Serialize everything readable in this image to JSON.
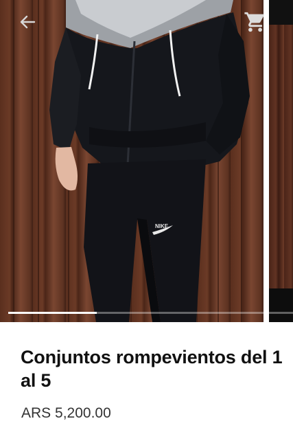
{
  "product": {
    "title": "Conjuntos rompevientos del 1 al 5",
    "price": "ARS 5,200.00",
    "image_logo": "NIKE"
  },
  "gallery": {
    "progress": 0.31
  },
  "icons": {
    "back": "arrow-left-icon",
    "cart": "shopping-cart-icon"
  },
  "colors": {
    "jacket_dark": "#15171c",
    "jacket_light": "#9a9ea3",
    "wood": "#5a2f1e"
  }
}
